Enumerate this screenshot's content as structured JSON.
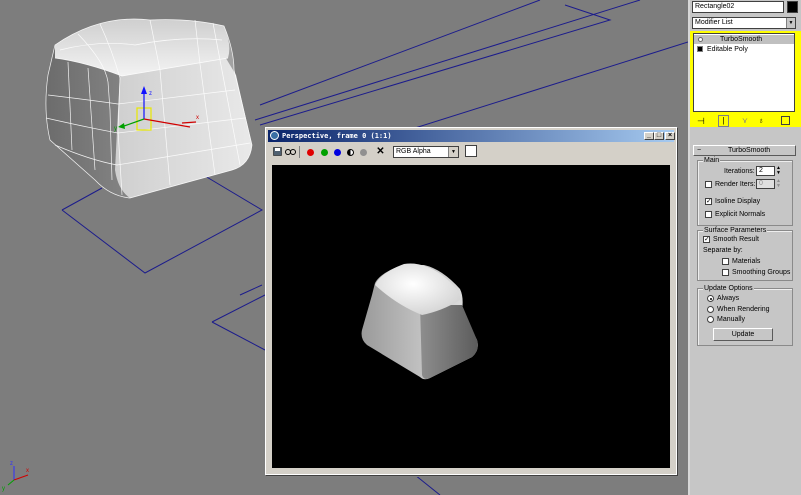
{
  "panel": {
    "object_name": "Rectangle02",
    "modifier_list_label": "Modifier List",
    "stack": [
      {
        "label": "TurboSmooth",
        "selected": true
      },
      {
        "label": "Editable Poly",
        "selected": false
      }
    ],
    "rollout_title": "TurboSmooth",
    "main": {
      "title": "Main",
      "iterations_label": "Iterations:",
      "iterations_value": "2",
      "render_iters_label": "Render Iters:",
      "render_iters_value": "0",
      "isoline_label": "Isoline Display",
      "isoline_checked": true,
      "explicit_normals_label": "Explicit Normals",
      "explicit_normals_checked": false
    },
    "surface": {
      "title": "Surface Parameters",
      "smooth_result_label": "Smooth Result",
      "smooth_result_checked": true,
      "separate_by_label": "Separate by:",
      "materials_label": "Materials",
      "smoothing_groups_label": "Smoothing Groups"
    },
    "update": {
      "title": "Update Options",
      "always_label": "Always",
      "when_rendering_label": "When Rendering",
      "manually_label": "Manually",
      "selected": "Always",
      "update_button_label": "Update"
    }
  },
  "render_window": {
    "title": "Perspective, frame 0 (1:1)",
    "channel_select": "RGB Alpha"
  },
  "colors": {
    "selection_highlight": "#ffff00",
    "title_bar": "#0a246a",
    "viewport_bg": "#7d7d7d"
  }
}
